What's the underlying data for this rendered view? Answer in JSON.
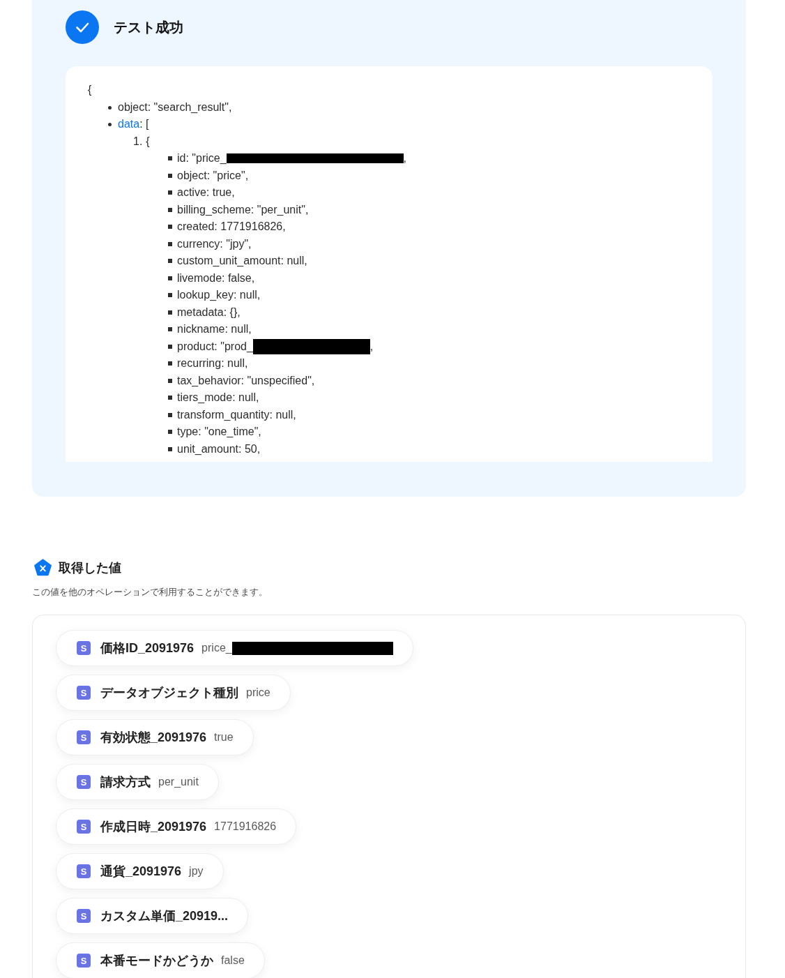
{
  "test_result": {
    "title": "テスト成功"
  },
  "output": {
    "opening": "{",
    "fields": [
      {
        "kind": "text",
        "text": "object: \"search_result\","
      },
      {
        "kind": "link",
        "key": "data",
        "text": ": [",
        "children": [
          {
            "number": "1.",
            "text": "{",
            "children": [
              {
                "text": "id: \"price_",
                "redacted": true,
                "after": ","
              },
              {
                "text": "object: \"price\",",
                "redacted": false
              },
              {
                "text": "active: true,",
                "redacted": false
              },
              {
                "text": "billing_scheme: \"per_unit\",",
                "redacted": false
              },
              {
                "text": "created: 1771916826,",
                "redacted": false
              },
              {
                "text": "currency: \"jpy\",",
                "redacted": false
              },
              {
                "text": "custom_unit_amount: null,",
                "redacted": false
              },
              {
                "text": "livemode: false,",
                "redacted": false
              },
              {
                "text": "lookup_key: null,",
                "redacted": false
              },
              {
                "text": "metadata: {},",
                "redacted": false
              },
              {
                "text": "nickname: null,",
                "redacted": false
              },
              {
                "text": "product: \"prod_",
                "redacted": true,
                "after": ","
              },
              {
                "text": "recurring: null,",
                "redacted": false
              },
              {
                "text": "tax_behavior: \"unspecified\",",
                "redacted": false
              },
              {
                "text": "tiers_mode: null,",
                "redacted": false
              },
              {
                "text": "transform_quantity: null,",
                "redacted": false
              },
              {
                "text": "type: \"one_time\",",
                "redacted": false
              },
              {
                "text": "unit_amount: 50,",
                "redacted": false
              }
            ]
          }
        ]
      }
    ]
  },
  "captured_values": {
    "title": "取得した値",
    "description": "この値を他のオペレーションで利用することができます。",
    "items": [
      {
        "badge": "S",
        "label": "価格ID_2091976",
        "value": "price_",
        "redacted": true
      },
      {
        "badge": "S",
        "label": "データオブジェクト種別",
        "value": "price",
        "redacted": false
      },
      {
        "badge": "S",
        "label": "有効状態_2091976",
        "value": "true",
        "redacted": false
      },
      {
        "badge": "S",
        "label": "請求方式",
        "value": "per_unit",
        "redacted": false
      },
      {
        "badge": "S",
        "label": "作成日時_2091976",
        "value": "1771916826",
        "redacted": false
      },
      {
        "badge": "S",
        "label": "通貨_2091976",
        "value": "jpy",
        "redacted": false
      },
      {
        "badge": "S",
        "label": "カスタム単価_20919...",
        "redacted": false
      },
      {
        "badge": "S",
        "label": "本番モードかどうか",
        "value": "false",
        "redacted": false
      }
    ]
  }
}
